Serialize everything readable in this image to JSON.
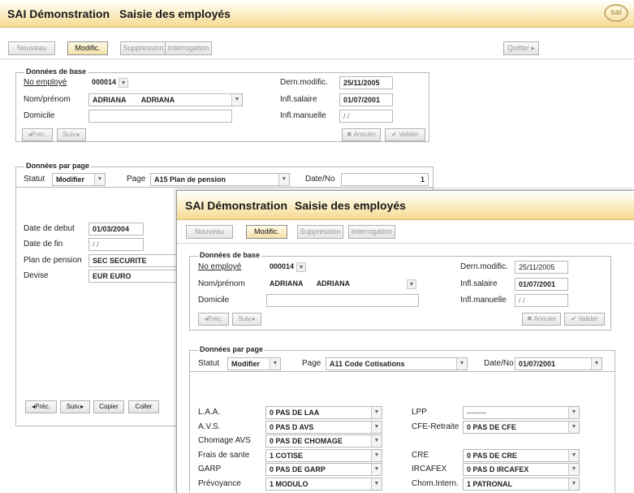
{
  "app_title": "SAI Démonstration",
  "screen_title": "Saisie des employés",
  "logo_text": "sai",
  "toolbar": {
    "new": "Nouveau",
    "modify": "Modific.",
    "delete": "Suppression",
    "query": "Interrogation",
    "quit": "Quitter"
  },
  "base": {
    "legend": "Données de base",
    "employee_no_label": "No employé",
    "employee_no": "000014",
    "name_label": "Nom/prénom",
    "last_name": "ADRIANA",
    "first_name": "ADRIANA",
    "home_label": "Domicile",
    "home_value": "",
    "last_mod_label": "Dern.modific.",
    "last_mod": "25/11/2005",
    "salary_label": "Infl.salaire",
    "salary_date": "01/07/2001",
    "manual_label": "Infl.manuelle",
    "manual_value": "/ /",
    "prev": "Préc.",
    "next": "Suiv.",
    "cancel": "Annuler",
    "validate": "Valider"
  },
  "page1": {
    "legend": "Données par page",
    "status_label": "Statut",
    "status": "Modifier",
    "page_label": "Page",
    "page": "A15 Plan de pension",
    "date_label": "Date/No",
    "date_value": "1",
    "start_label": "Date de debut",
    "start": "01/03/2004",
    "end_label": "Date de fin",
    "end": "/ /",
    "plan_label": "Plan de pension",
    "plan": "SEC SECURITE",
    "currency_label": "Devise",
    "currency": "EUR EURO",
    "prev": "Préc.",
    "next": "Suiv.",
    "copy": "Copier",
    "paste": "Coller"
  },
  "page2": {
    "legend": "Données par page",
    "status_label": "Statut",
    "status": "Modifier",
    "page_label": "Page",
    "page": "A11 Code Cotisations",
    "date_label": "Date/No",
    "date_value": "01/07/2001",
    "rows": [
      {
        "l1": "L.A.A.",
        "v1": "0 PAS DE LAA",
        "l2": "LPP",
        "v2": "--------"
      },
      {
        "l1": "A.V.S.",
        "v1": "0 PAS D AVS",
        "l2": "CFE-Retraite",
        "v2": "0 PAS DE CFE"
      },
      {
        "l1": "Chomage AVS",
        "v1": "0 PAS DE CHOMAGE",
        "l2": "",
        "v2": ""
      },
      {
        "l1": "Frais de sante",
        "v1": "1 COTISE",
        "l2": "CRE",
        "v2": "0 PAS DE CRE"
      },
      {
        "l1": "GARP",
        "v1": "0 PAS DE GARP",
        "l2": "IRCAFEX",
        "v2": "0 PAS D IRCAFEX"
      },
      {
        "l1": "Prévoyance",
        "v1": "1 MODULO",
        "l2": "Chom.Intern.",
        "v2": "1 PATRONAL"
      }
    ]
  }
}
